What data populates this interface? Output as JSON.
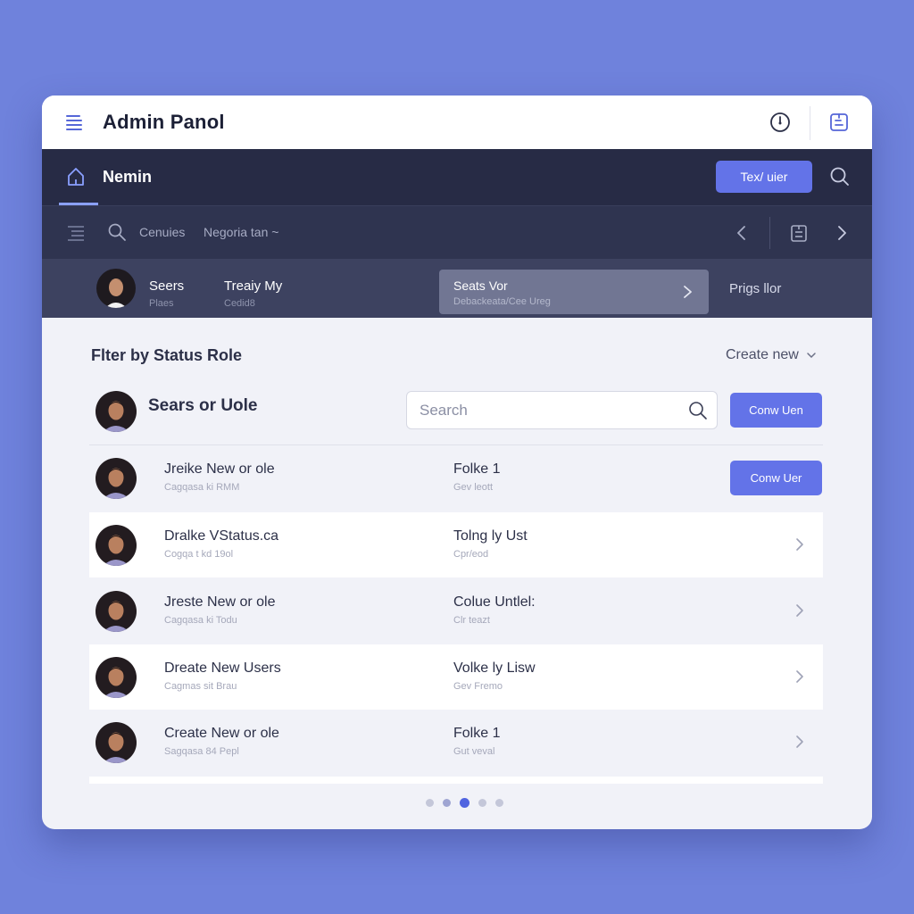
{
  "app": {
    "title": "Admin Panol"
  },
  "navbar": {
    "title": "Nemin",
    "button_label": "Tex/ uier"
  },
  "toolbar": {
    "item1": "Cenuies",
    "item2": "Negoria tan ~"
  },
  "strip": {
    "user1_name": "Seers",
    "user1_sub": "Plaes",
    "user2_name": "Treaiy My",
    "user2_sub": "Cedid8",
    "card_title": "Seats Vor",
    "card_sub": "Debackeata/Cee Ureg",
    "right_label": "Prigs llor"
  },
  "content": {
    "filter_title": "Flter by Status Role",
    "create_new": "Create new",
    "header_name": "Sears or Uole",
    "search_placeholder": "Search",
    "header_button": "Conw Uen"
  },
  "rows": [
    {
      "name": "Jreike New or ole",
      "sub": "Cagqasa ki RMM",
      "role": "Folke 1",
      "rsub": "Gev leott",
      "button": "Conw Uer"
    },
    {
      "name": "Dralke VStatus.ca",
      "sub": "Cogqa t kd 19ol",
      "role": "Tolng ly Ust",
      "rsub": "Cpr/eod"
    },
    {
      "name": "Jreste New or ole",
      "sub": "Cagqasa ki Todu",
      "role": "Colue Untlel:",
      "rsub": "Clr teazt"
    },
    {
      "name": "Dreate New Users",
      "sub": "Cagmas sit Brau",
      "role": "Volke ly Lisw",
      "rsub": "Gev Fremo"
    },
    {
      "name": "Create New or ole",
      "sub": "Sagqasa 84 Pepl",
      "role": "Folke 1",
      "rsub": "Gut veval"
    }
  ],
  "colors": {
    "accent": "#6373e8",
    "nav_dark": "#272b45",
    "background": "#6f82dc",
    "active_dot": "#5064e0"
  },
  "pagination": {
    "total_pages": 5,
    "active_page": 3
  }
}
